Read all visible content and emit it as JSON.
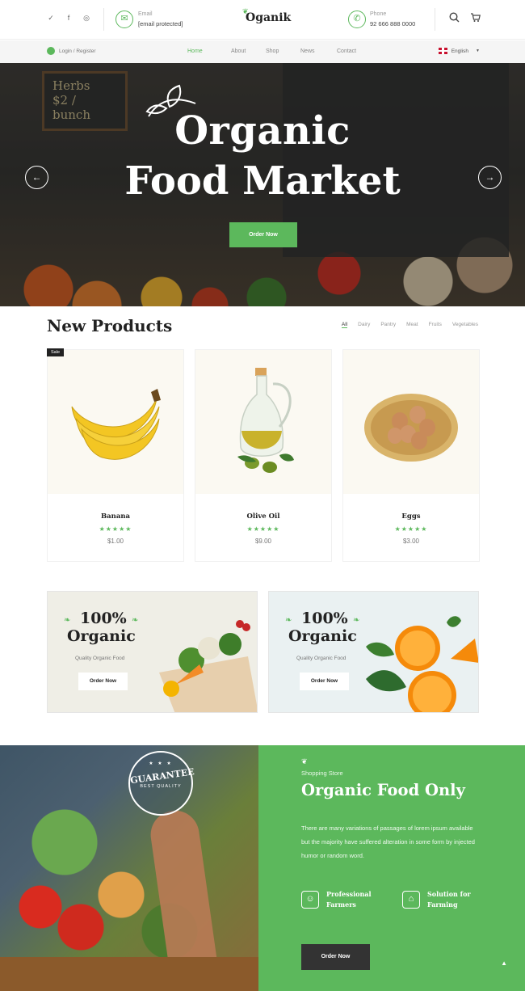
{
  "topbar": {
    "social": [
      "twitter-icon",
      "facebook-icon",
      "instagram-icon"
    ],
    "email_label": "Email",
    "email_value": "[email protected]",
    "logo": "Oganik",
    "phone_label": "Phone",
    "phone_value": "92 666 888 0000"
  },
  "navbar": {
    "login": "Login / Register",
    "menu": [
      "Home",
      "About",
      "Shop",
      "News",
      "Contact"
    ],
    "active_menu": "Home",
    "language": "English"
  },
  "hero": {
    "title_line1": "Organic",
    "title_line2": "Food Market",
    "button": "Order Now",
    "prev_arrow": "←",
    "next_arrow": "→"
  },
  "products": {
    "title": "New Products",
    "filters": [
      "All",
      "Dairy",
      "Pantry",
      "Meat",
      "Fruits",
      "Vegetables"
    ],
    "active_filter": "All",
    "sale_badge": "Sale",
    "items": [
      {
        "name": "Banana",
        "price": "$1.00",
        "rating": 5
      },
      {
        "name": "Olive Oil",
        "price": "$9.00",
        "rating": 5
      },
      {
        "name": "Eggs",
        "price": "$3.00",
        "rating": 5
      }
    ]
  },
  "banners": [
    {
      "line1": "100%",
      "line2": "Organic",
      "sub": "Quality Organic Food",
      "button": "Order Now"
    },
    {
      "line1": "100%",
      "line2": "Organic",
      "sub": "Quality Organic Food",
      "button": "Order Now"
    }
  ],
  "guarantee_badge": {
    "main": "GUARANTEE",
    "sub": "BEST QUALITY",
    "stars": "★ ★ ★"
  },
  "feature_section": {
    "label": "Shopping Store",
    "title": "Organic Food Only",
    "text": "There are many variations of passages of lorem ipsum available but the majority have suffered alteration in some form by injected humor or random word.",
    "features": [
      {
        "label": "Professional Farmers",
        "icon": "farmer-icon"
      },
      {
        "label": "Solution for Farming",
        "icon": "barn-icon"
      }
    ],
    "button": "Order Now",
    "back_to_top": "▲"
  },
  "colors": {
    "accent": "#5cb85c",
    "dark": "#222222",
    "button_dark": "#333333"
  }
}
